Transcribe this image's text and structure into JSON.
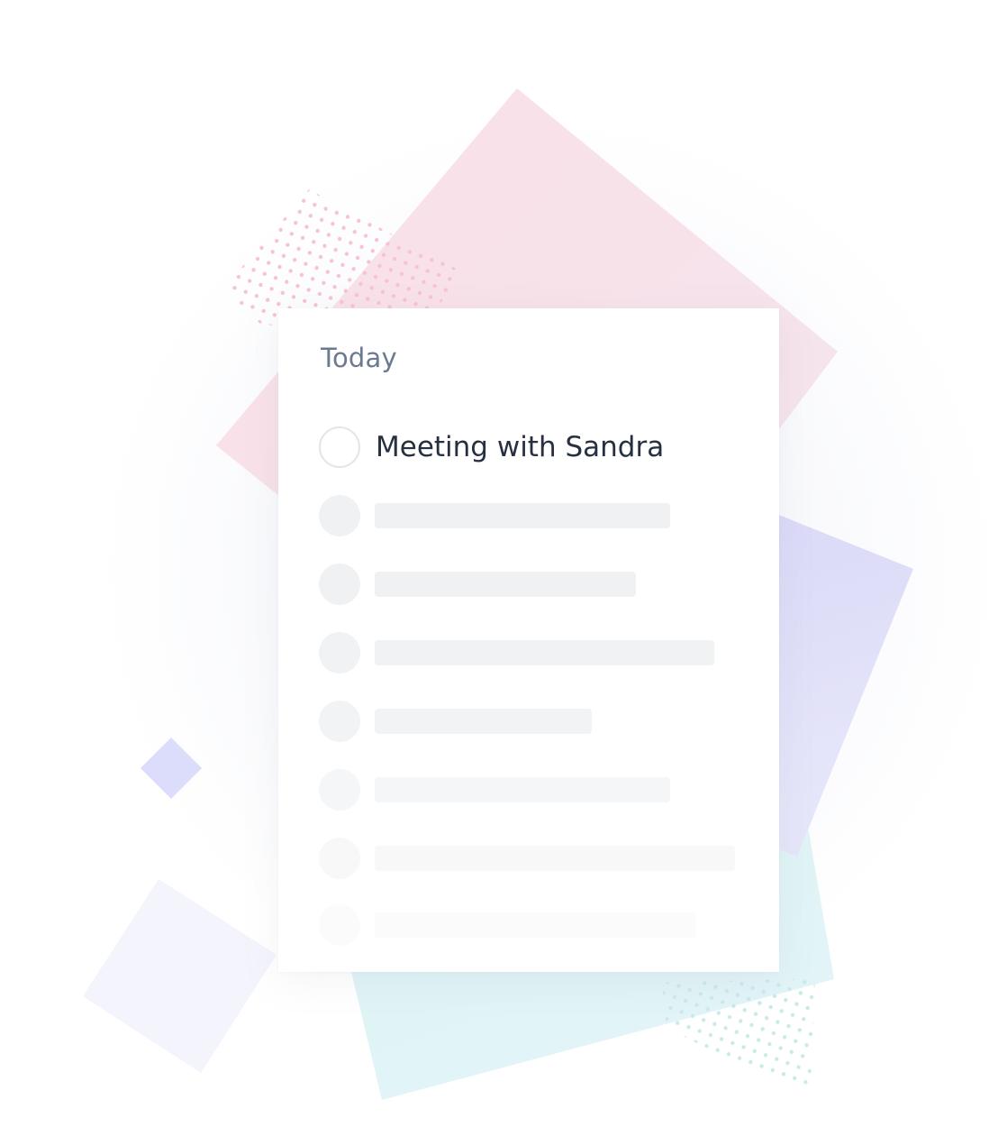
{
  "card": {
    "title": "Today",
    "task": {
      "label": "Meeting with Sandra",
      "checked": false
    },
    "placeholder_rows": 7
  },
  "colors": {
    "pink_shape": "#f9dde6",
    "lavender_shape": "#d6d5f6",
    "mint_shape": "#d9f1f1",
    "small_diamond": "#dcdcfb",
    "pale_square": "#f3f3fd",
    "title_text": "#6b7a90",
    "task_text": "#263040",
    "placeholder": "#f1f2f4"
  }
}
